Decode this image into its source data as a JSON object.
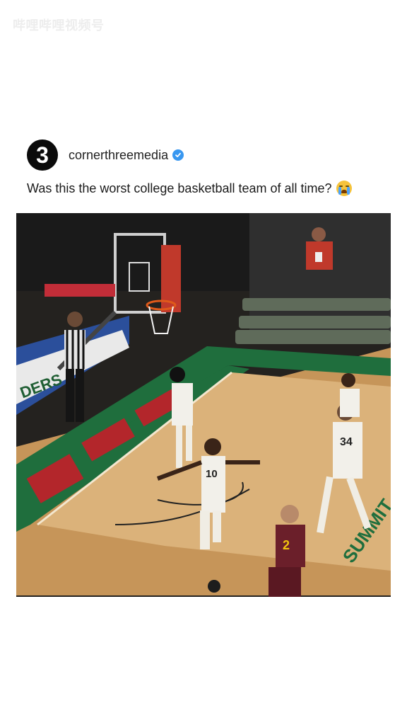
{
  "watermark": {
    "text": "哔哩哔哩视频号"
  },
  "post": {
    "avatar_text": "3",
    "username": "cornerthreemedia",
    "verified": true,
    "caption": "Was this the worst college basketball team of all time?",
    "caption_emoji": "loudly-crying-face-emoji"
  },
  "video": {
    "banner_left": "DERS",
    "baseline_text": "SUMMIT",
    "players": [
      {
        "number": "10"
      },
      {
        "number": "34"
      },
      {
        "number": "2"
      }
    ]
  },
  "colors": {
    "court_wood": "#c99a5f",
    "court_green": "#1f6e3d",
    "paint_red": "#b3262b",
    "away_jersey": "#6b1f2a",
    "home_jersey": "#f2f0ea",
    "verified_blue": "#3897f0"
  }
}
